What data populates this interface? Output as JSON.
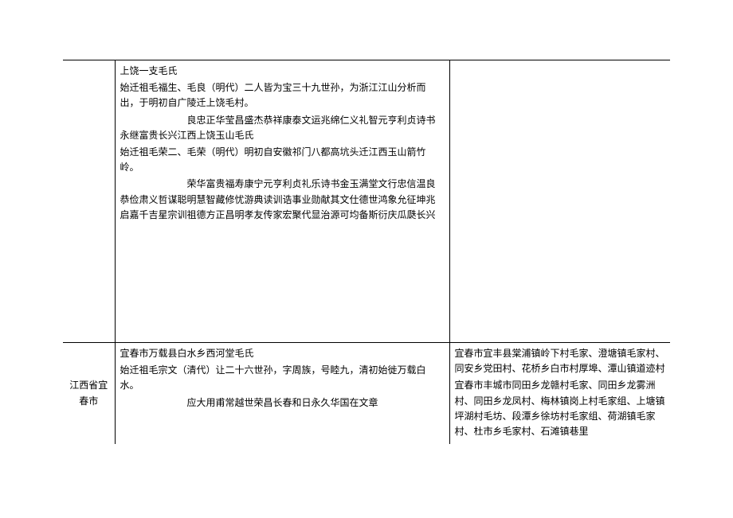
{
  "rows": [
    {
      "label": "",
      "content": {
        "p1": "上饶一支毛氏",
        "p2": "始迁祖毛福生、毛良（明代）二人皆为宝三十九世孙，为浙江江山分析而出，于明初自广陵迁上饶毛村。",
        "p3": "良忠正华莹昌盛杰恭祥康泰文运兆绵仁义礼智元亨利贞诗书永继富贵长兴江西上饶玉山毛氏",
        "p4": "始迁祖毛荣二、毛荣（明代）明初自安徽祁门八都高坑头迁江西玉山箭竹岭。",
        "p5": "荣华富贵福寿康宁元亨利贞礼乐诗书金玉满堂文行忠信温良恭俭肃义哲谋聪明慧智藏修忧游典读训诰事业勋献其文仕德世鸿象允征坤兆启嘉千吉星宗训祖德方正昌明孝友传家宏聚代显治源可均备斯衍庆瓜瓞长兴"
      },
      "places": ""
    },
    {
      "label": "江西省宜春市",
      "content": {
        "p1": "宜春市万载县白水乡西河堂毛氏",
        "p2": "始迁祖毛宗文（清代）让二十六世孙，字周族，号睦九，清初始徙万载白水。",
        "p3": "应大用甫常越世荣昌长春和日永久华国在文章"
      },
      "places": {
        "p1": "宜春市宜丰县棠浦镇岭下村毛家、澄塘镇毛家村、同安乡党田村、花桥乡白市村厚埠、潭山镇道迹村",
        "p2": "宜春市丰城市同田乡龙赣村毛家、同田乡龙雾洲村、同田乡龙凤村、梅林镇岗上村毛家组、上塘镇坪湖村毛坊、段潭乡徐坊村毛家组、荷湖镇毛家村、杜市乡毛家村、石滩镇巷里"
      }
    }
  ]
}
